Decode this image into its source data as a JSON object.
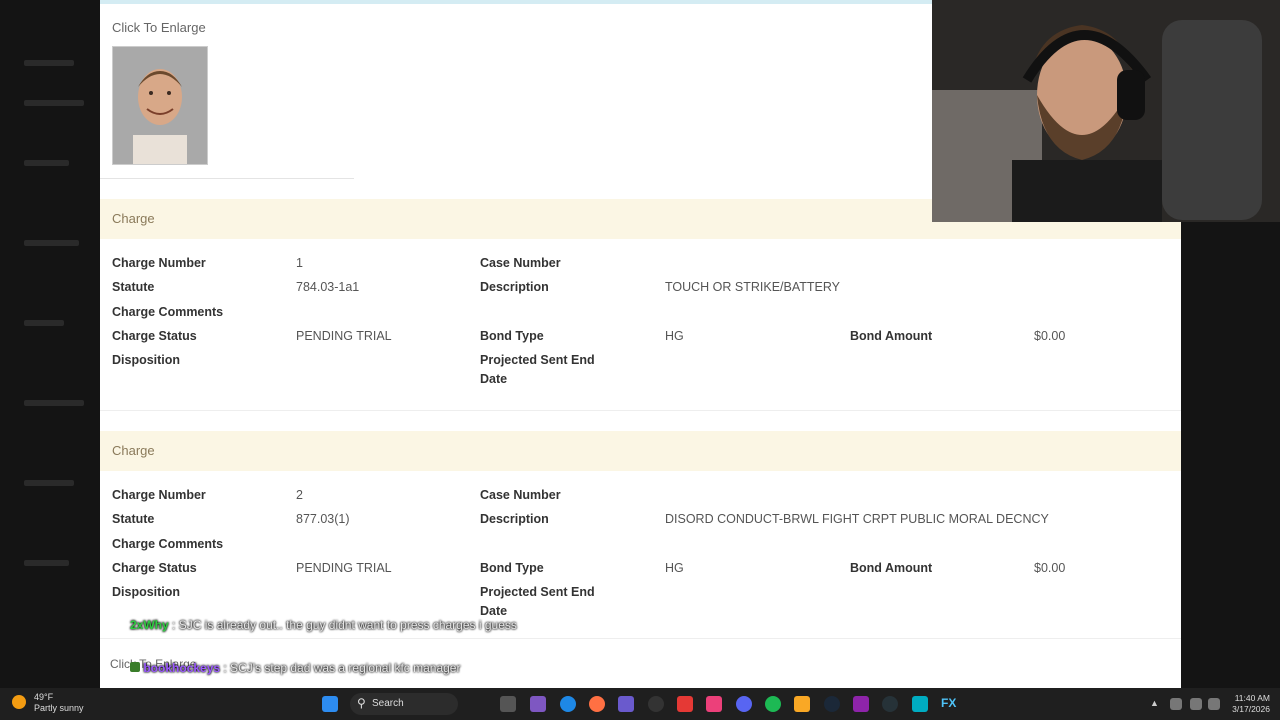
{
  "page": {
    "click_to_enlarge": "Click To Enlarge",
    "charges": [
      {
        "header": "Charge",
        "charge_number_label": "Charge Number",
        "charge_number": "1",
        "statute_label": "Statute",
        "statute": "784.03-1a1",
        "comments_label": "Charge Comments",
        "status_label": "Charge Status",
        "status": "PENDING TRIAL",
        "disposition_label": "Disposition",
        "case_number_label": "Case Number",
        "description_label": "Description",
        "description": "TOUCH OR STRIKE/BATTERY",
        "bond_type_label": "Bond Type",
        "bond_type": "HG",
        "bond_amount_label": "Bond Amount",
        "bond_amount": "$0.00",
        "projected_label": "Projected Sent End Date"
      },
      {
        "header": "Charge",
        "charge_number_label": "Charge Number",
        "charge_number": "2",
        "statute_label": "Statute",
        "statute": "877.03(1)",
        "comments_label": "Charge Comments",
        "status_label": "Charge Status",
        "status": "PENDING TRIAL",
        "disposition_label": "Disposition",
        "case_number_label": "Case Number",
        "description_label": "Description",
        "description": "DISORD CONDUCT-BRWL FIGHT CRPT PUBLIC MORAL DECNCY",
        "bond_type_label": "Bond Type",
        "bond_type": "HG",
        "bond_amount_label": "Bond Amount",
        "bond_amount": "$0.00",
        "projected_label": "Projected Sent End Date"
      }
    ],
    "click_to_enlarge_bottom": "Click To Enlarge"
  },
  "chat": [
    {
      "user": "2xWhy",
      "message": ": SJC is already out.. the guy didnt want to press charges i guess"
    },
    {
      "user": "bookhockeys",
      "message": ": SCJ's step dad was a regional kfc manager"
    }
  ],
  "taskbar": {
    "temperature": "49°F",
    "weather": "Partly sunny",
    "search_placeholder": "Search",
    "time": "11:40 AM",
    "date": "3/17/2026",
    "fx_label": "FX"
  },
  "colors": {
    "charge_header_bg": "#fbf6e4",
    "chat_user1": "#2ecc40",
    "chat_user2": "#9b59ff"
  }
}
